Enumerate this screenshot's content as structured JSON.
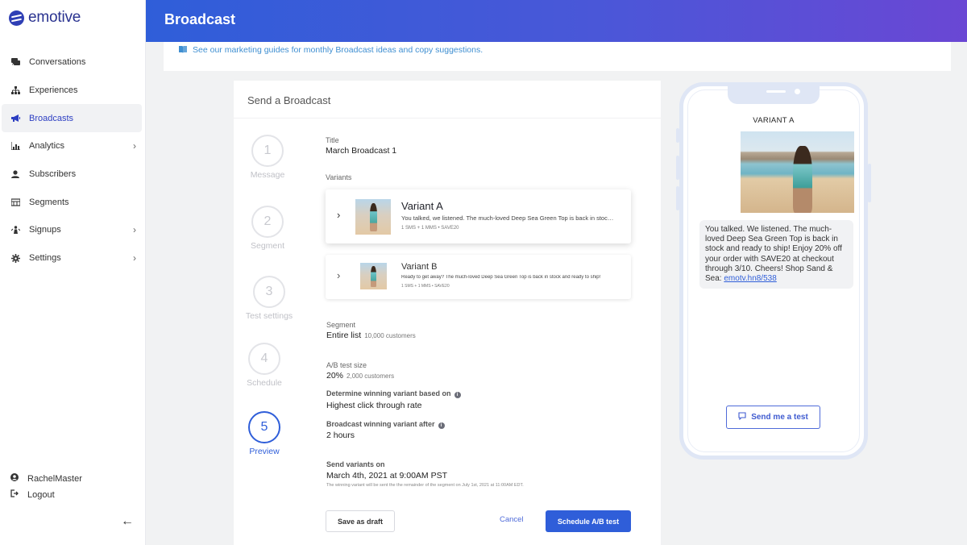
{
  "app": {
    "name": "emotive"
  },
  "sidebar": {
    "items": [
      {
        "label": "Conversations",
        "icon": "chat-icon",
        "active": false,
        "has_chevron": false
      },
      {
        "label": "Experiences",
        "icon": "sitemap-icon",
        "active": false,
        "has_chevron": false
      },
      {
        "label": "Broadcasts",
        "icon": "megaphone-icon",
        "active": true,
        "has_chevron": false
      },
      {
        "label": "Analytics",
        "icon": "analytics-icon",
        "active": false,
        "has_chevron": true
      },
      {
        "label": "Subscribers",
        "icon": "user-icon",
        "active": false,
        "has_chevron": false
      },
      {
        "label": "Segments",
        "icon": "segments-icon",
        "active": false,
        "has_chevron": false
      },
      {
        "label": "Signups",
        "icon": "signups-icon",
        "active": false,
        "has_chevron": true
      },
      {
        "label": "Settings",
        "icon": "gear-icon",
        "active": false,
        "has_chevron": true
      }
    ],
    "user_label": "RachelMaster",
    "logout_label": "Logout"
  },
  "header": {
    "title": "Broadcast"
  },
  "banner": {
    "text": "See our marketing guides for monthly Broadcast ideas and copy suggestions."
  },
  "card": {
    "title": "Send a Broadcast",
    "steps": [
      {
        "number": "1",
        "label": "Message",
        "active": false
      },
      {
        "number": "2",
        "label": "Segment",
        "active": false
      },
      {
        "number": "3",
        "label": "Test settings",
        "active": false
      },
      {
        "number": "4",
        "label": "Schedule",
        "active": false
      },
      {
        "number": "5",
        "label": "Preview",
        "active": true
      }
    ],
    "title_label": "Title",
    "title_value": "March Broadcast 1",
    "variants_label": "Variants",
    "variants": [
      {
        "name": "Variant A",
        "description": "You talked, we listened. The much-loved Deep Sea Green Top is back in stock and ready to ship!",
        "meta": "1 SMS + 1 MMS • SAVE20"
      },
      {
        "name": "Variant B",
        "description": "Ready to get away? The much-loved Deep Sea Green Top is back in stock and ready to ship!",
        "meta": "1 SMS + 1 MMS • SAVE20"
      }
    ],
    "segment_label": "Segment",
    "segment_value": "Entire list",
    "segment_count": "10,000 customers",
    "ab_label": "A/B test size",
    "ab_value": "20%",
    "ab_count": "2,000 customers",
    "winning_basis_label": "Determine winning variant based on",
    "winning_basis_value": "Highest click through rate",
    "winning_after_label": "Broadcast winning variant after",
    "winning_after_value": "2 hours",
    "send_on_label": "Send variants on",
    "send_on_value": "March 4th, 2021 at 9:00AM PST",
    "send_on_note": "The winning variant will be sent the the remainder of the segment on July 1st, 2021 at 11:00AM EDT.",
    "draft_button": "Save as draft",
    "cancel_button": "Cancel",
    "schedule_button": "Schedule A/B test"
  },
  "phone": {
    "variant_label": "VARIANT A",
    "message": "You talked. We listened. The much-loved Deep Sea Green Top is back in stock and ready to ship! Enjoy 20% off your order with SAVE20 at checkout through 3/10. Cheers! Shop Sand & Sea:",
    "link": "emotv.hn8/538",
    "send_test_button": "Send me a test"
  },
  "colors": {
    "accent": "#2f5ed9",
    "header_gradient_start": "#2f5ed9",
    "header_gradient_end": "#6a47d4",
    "link": "#3f8fd1"
  }
}
